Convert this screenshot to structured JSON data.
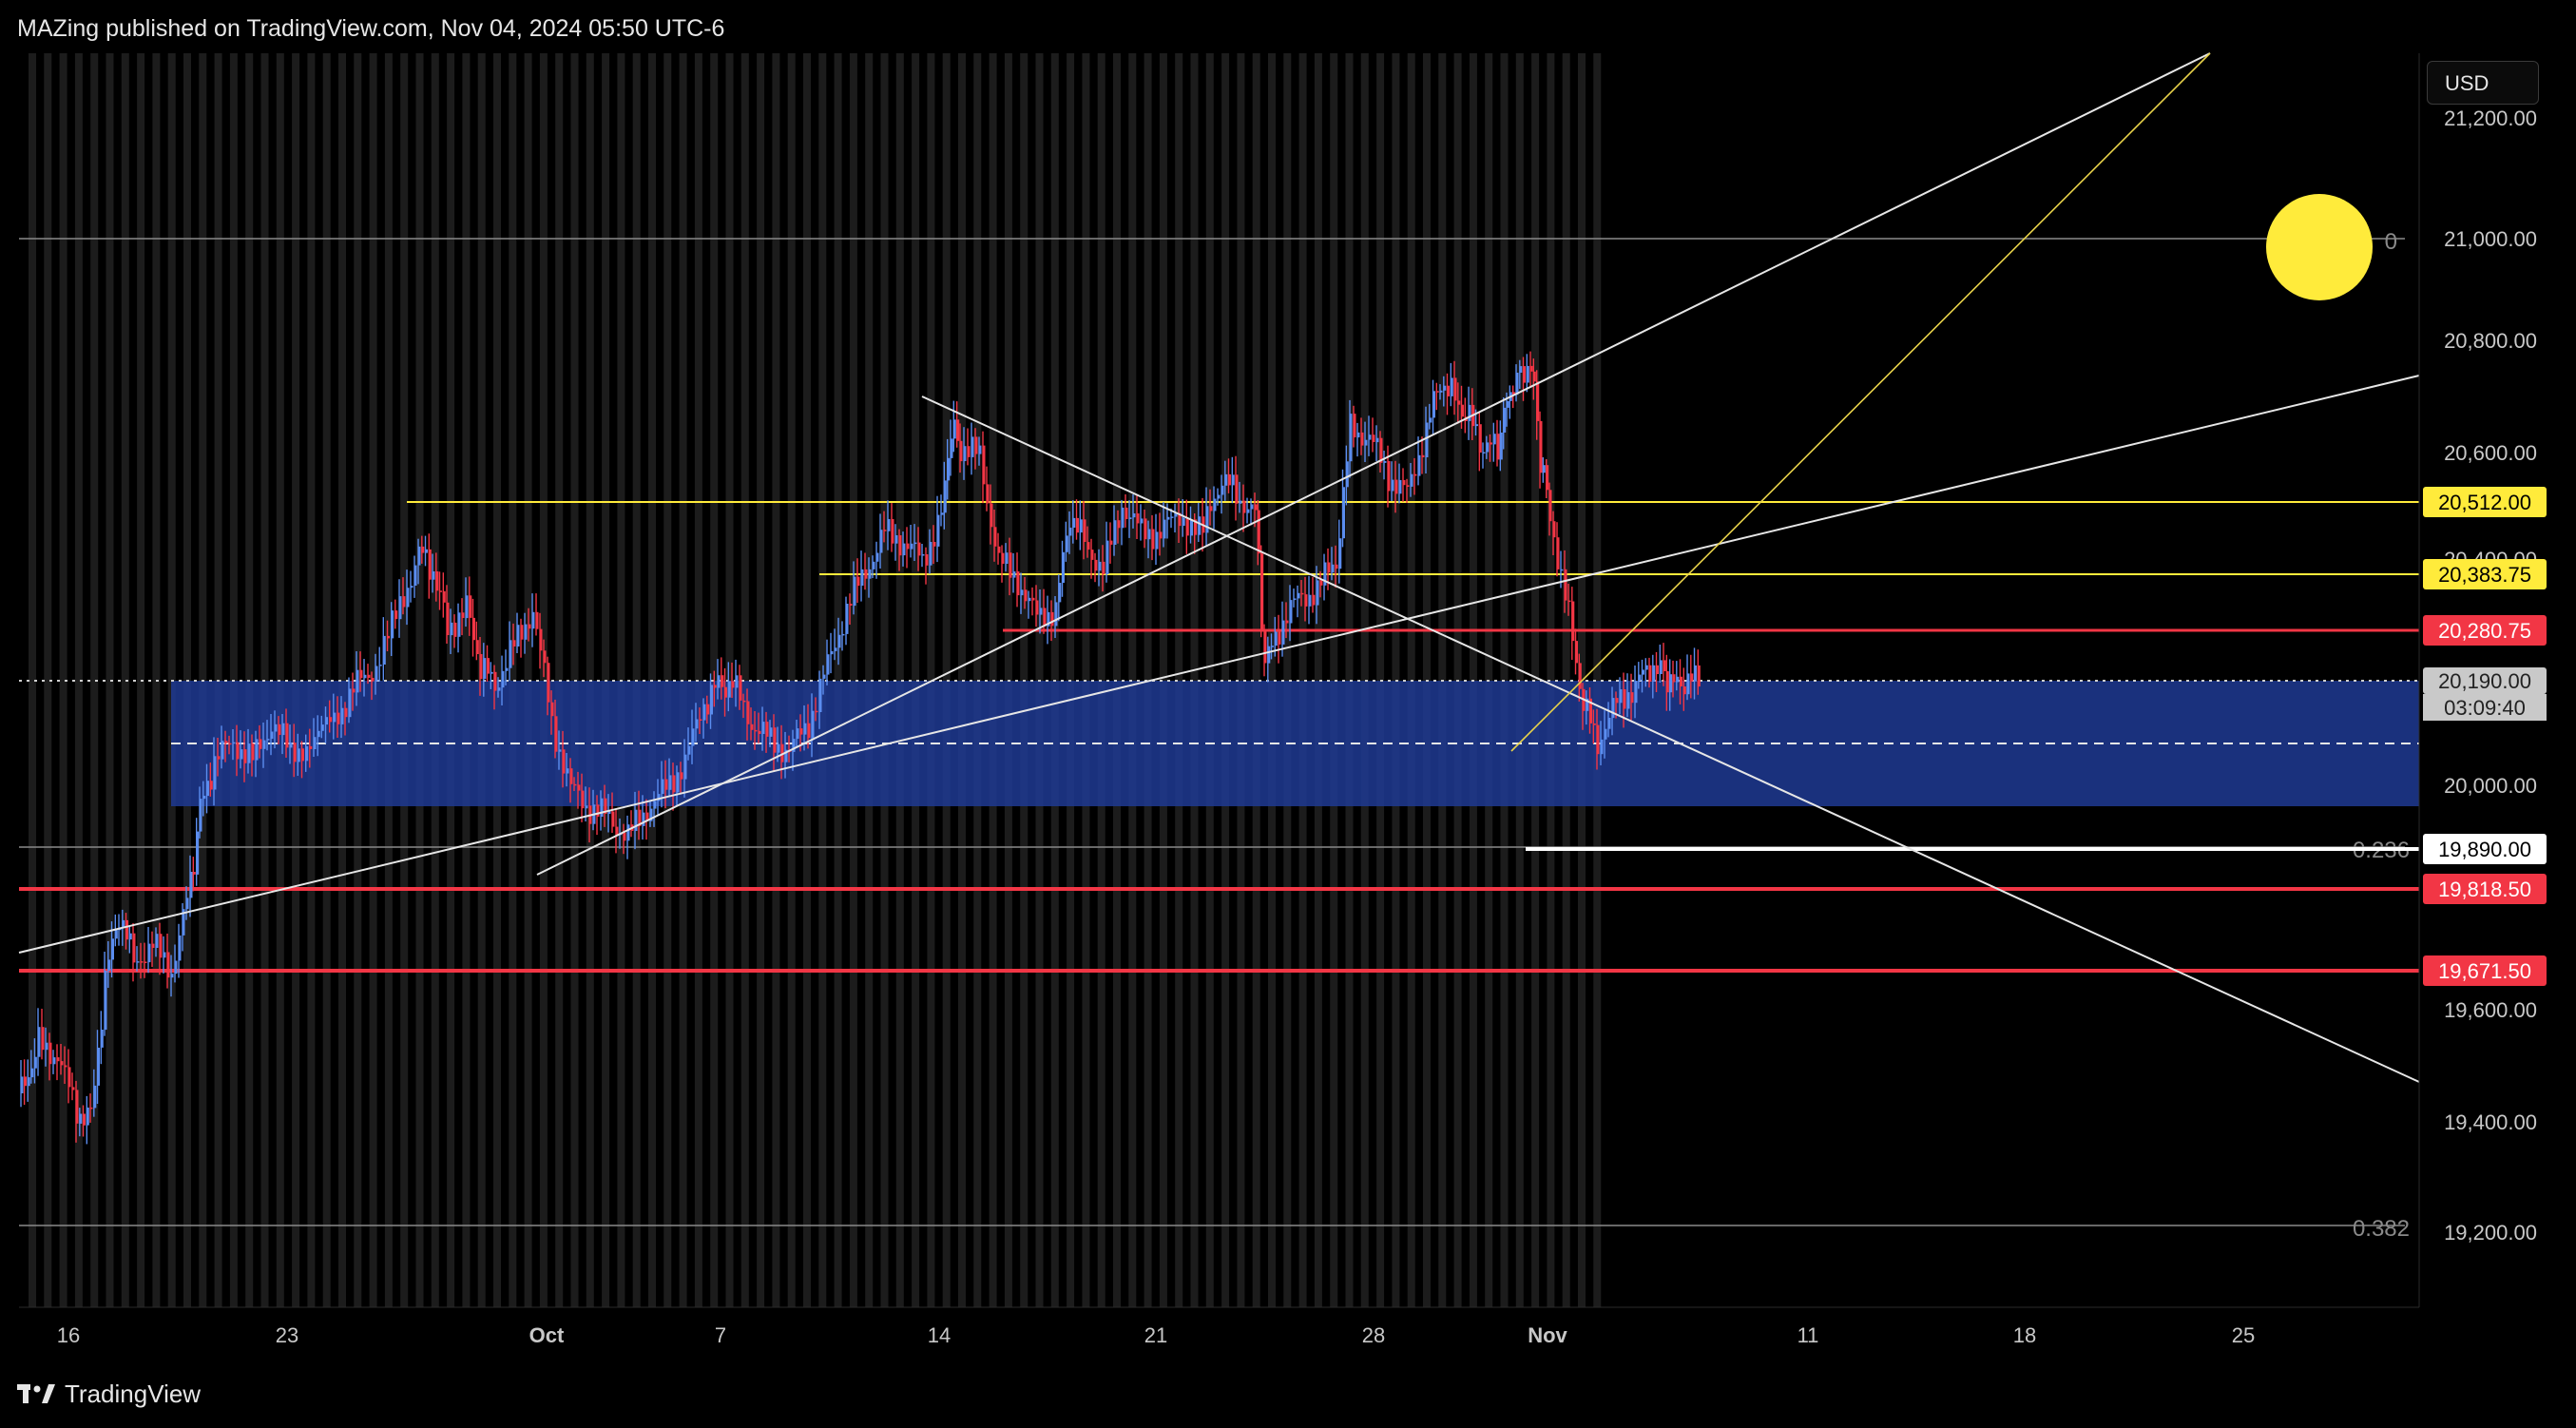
{
  "header": {
    "published_line": "MAZing published on TradingView.com, Nov 04, 2024 05:50 UTC-6"
  },
  "footer": {
    "brand": "TradingView"
  },
  "currency_button": "USD",
  "chart_data": {
    "type": "candlestick",
    "y_axis_ticks": [
      "21,200.00",
      "21,000.00",
      "20,800.00",
      "20,600.00",
      "20,400.00",
      "20,000.00",
      "19,600.00",
      "19,400.00",
      "19,200.00"
    ],
    "x_axis_ticks": [
      "16",
      "23",
      "Oct",
      "7",
      "14",
      "21",
      "28",
      "Nov",
      "11",
      "18",
      "25"
    ],
    "price_labels": [
      {
        "text": "20,512.00",
        "style": "yellow"
      },
      {
        "text": "20,383.75",
        "style": "yellow"
      },
      {
        "text": "20,280.75",
        "style": "red"
      },
      {
        "text": "20,190.00",
        "style": "current"
      },
      {
        "text": "03:09:40",
        "style": "countdown"
      },
      {
        "text": "19,890.00",
        "style": "white"
      },
      {
        "text": "19,818.50",
        "style": "red"
      },
      {
        "text": "19,671.50",
        "style": "red"
      }
    ],
    "fib_labels": [
      "0",
      "0.236",
      "0.382"
    ],
    "colors": {
      "up": "#5b8def",
      "down": "#f23645",
      "yellow": "#ffeb3b",
      "zone": "#1f3a93",
      "red_line": "#f23645"
    }
  }
}
